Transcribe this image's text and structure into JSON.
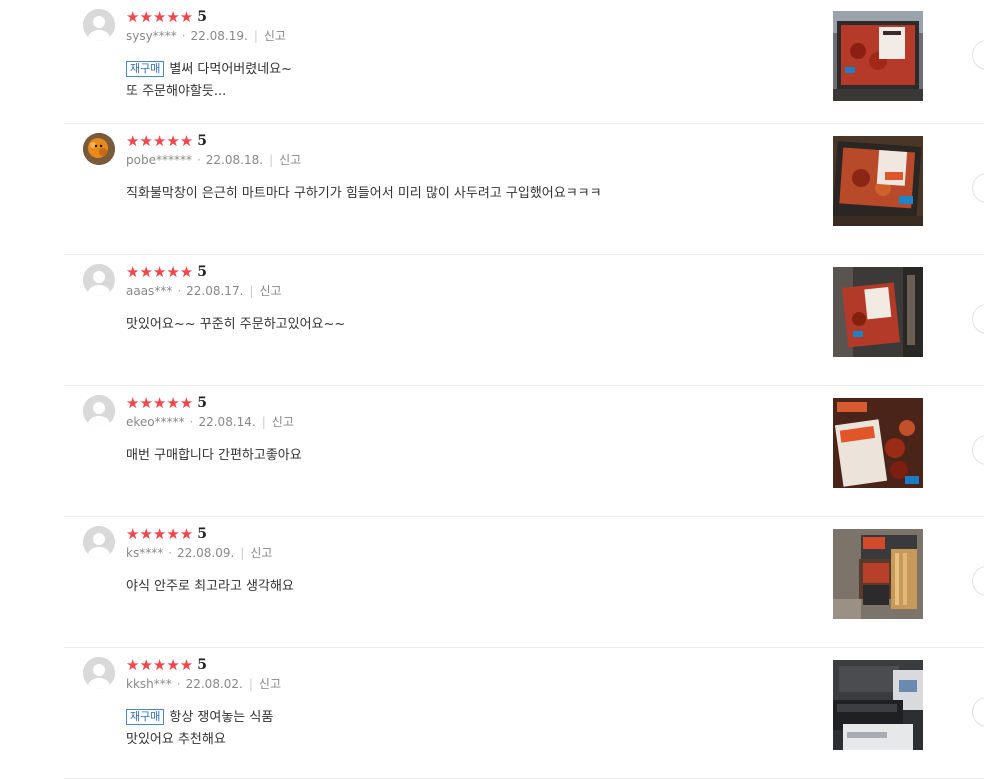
{
  "badge_label": "재구매",
  "report_label": "신고",
  "reviews": [
    {
      "rating": "5",
      "user": "sysy****",
      "date": "22.08.19.",
      "repurchase": true,
      "lines": [
        "별써 다먹어버렸네요~",
        "또 주문해야할듯..."
      ],
      "avatar": "default"
    },
    {
      "rating": "5",
      "user": "pobe******",
      "date": "22.08.18.",
      "repurchase": false,
      "lines": [
        "직화불막창이 은근히 마트마다 구하기가 힘들어서 미리 많이 사두려고 구입했어요ㅋㅋㅋ",
        ""
      ],
      "avatar": "custom"
    },
    {
      "rating": "5",
      "user": "aaas***",
      "date": "22.08.17.",
      "repurchase": false,
      "lines": [
        "맛있어요~~ 꾸준히 주문하고있어요~~",
        ""
      ],
      "avatar": "default"
    },
    {
      "rating": "5",
      "user": "ekeo*****",
      "date": "22.08.14.",
      "repurchase": false,
      "lines": [
        "매번 구매합니다 간편하고좋아요",
        ""
      ],
      "avatar": "default"
    },
    {
      "rating": "5",
      "user": "ks****",
      "date": "22.08.09.",
      "repurchase": false,
      "lines": [
        "야식 안주로 최고라고 생각해요",
        ""
      ],
      "avatar": "default"
    },
    {
      "rating": "5",
      "user": "kksh***",
      "date": "22.08.02.",
      "repurchase": true,
      "lines": [
        "항상 쟁여놓는 식품",
        "맛있어요 추천해요"
      ],
      "avatar": "default"
    }
  ],
  "colors": {
    "star": "#f2454c",
    "badge": "#2f6fb8",
    "divider": "#ececec"
  }
}
